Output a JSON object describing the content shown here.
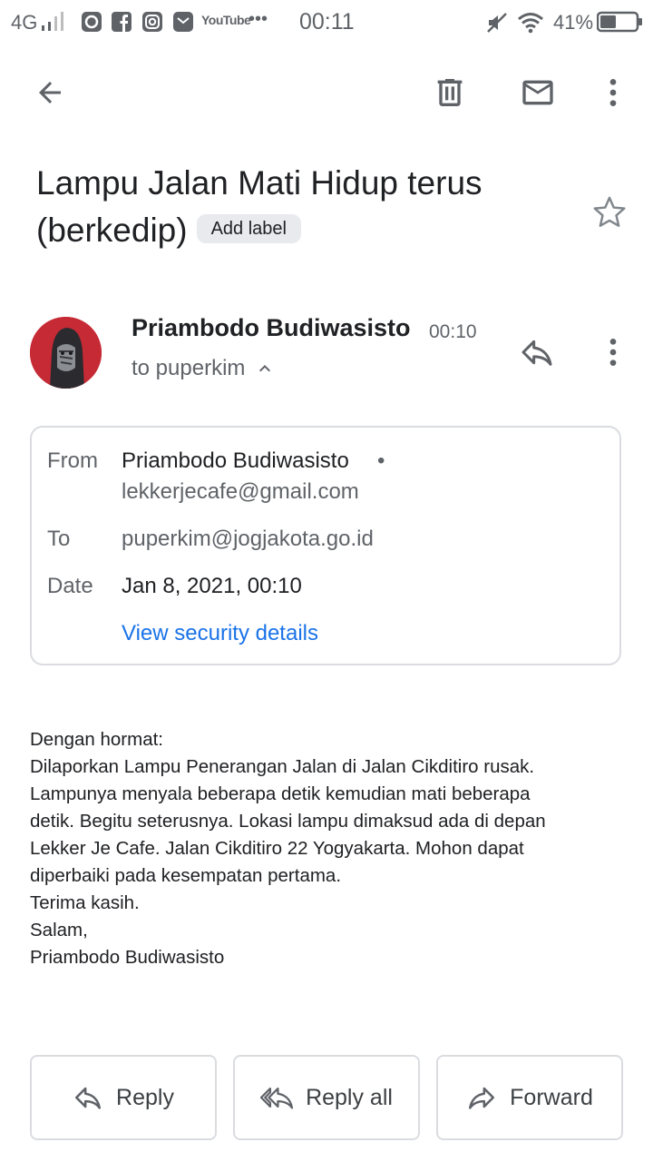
{
  "status_bar": {
    "network": "4G",
    "time": "00:11",
    "battery": "41%",
    "icons": [
      "signal-icon",
      "app-icon",
      "facebook-icon",
      "instagram-icon",
      "mail-icon",
      "youtube-icon",
      "more-dots-icon",
      "mute-icon",
      "wifi-icon",
      "battery-icon"
    ],
    "youtube_label": "YouTube",
    "more": "•••"
  },
  "app_bar": {
    "icons": [
      "back-arrow-icon",
      "delete-icon",
      "mark-unread-icon",
      "more-vert-icon"
    ]
  },
  "email": {
    "subject_line1": "Lampu Jalan Mati Hidup terus",
    "subject_line2": "(berkedip)",
    "label_chip": "Add label",
    "sender_name": "Priambodo Budiwasisto",
    "sent_time": "00:10",
    "to_summary": "to puperkim"
  },
  "details": {
    "from_label": "From",
    "from_name": "Priambodo Budiwasisto",
    "from_email": "lekkerjecafe@gmail.com",
    "to_label": "To",
    "to_email": "puperkim@jogjakota.go.id",
    "date_label": "Date",
    "date_value": "Jan 8, 2021, 00:10",
    "security_link": "View security details"
  },
  "body_lines": [
    "Dengan hormat:",
    "Dilaporkan Lampu Penerangan Jalan di Jalan Cikditiro rusak.",
    "Lampunya menyala beberapa detik kemudian mati beberapa",
    "detik. Begitu seterusnya. Lokasi lampu dimaksud ada di depan",
    "Lekker Je Cafe. Jalan Cikditiro 22 Yogyakarta. Mohon dapat",
    "diperbaiki pada kesempatan pertama.",
    "Terima kasih.",
    "Salam,",
    "Priambodo Budiwasisto"
  ],
  "actions": {
    "reply": "Reply",
    "reply_all": "Reply all",
    "forward": "Forward"
  },
  "colors": {
    "link": "#1a73e8",
    "secondary_text": "#5f6368",
    "border": "#dadce0",
    "chip_bg": "#e8eaed"
  }
}
